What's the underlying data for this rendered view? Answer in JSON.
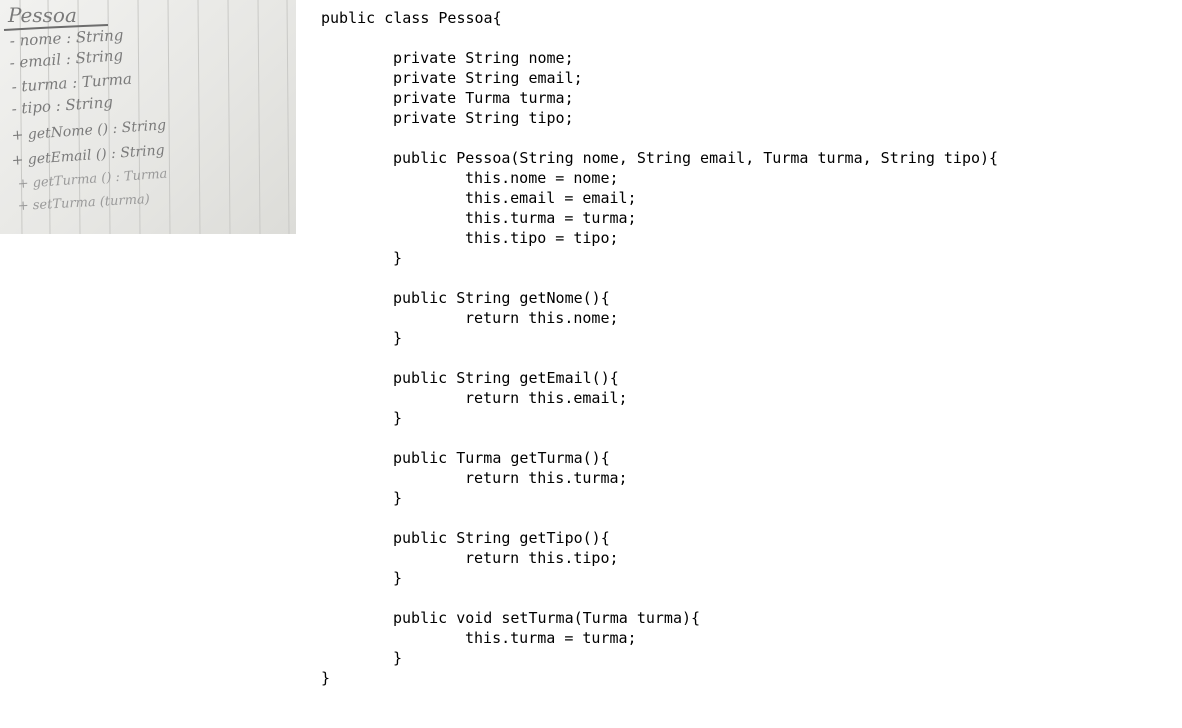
{
  "handwritten_note": {
    "lines": [
      "Pessoa",
      "- nome : String",
      "- email : String",
      "- turma : Turma",
      "- tipo : String",
      "+ getNome () : String",
      "+ getEmail () : String",
      "+ getTurma () : Turma",
      "+ setTurma (turma)"
    ]
  },
  "code": {
    "lines": [
      "public class Pessoa{",
      "",
      "private String nome;",
      "private String email;",
      "private Turma turma;",
      "private String tipo;",
      "",
      "public Pessoa(String nome, String email, Turma turma, String tipo){",
      "this.nome = nome;",
      "this.email = email;",
      "this.turma = turma;",
      "this.tipo = tipo;",
      "}",
      "",
      "public String getNome(){",
      "return this.nome;",
      "}",
      "",
      "public String getEmail(){",
      "return this.email;",
      "}",
      "",
      "public Turma getTurma(){",
      "return this.turma;",
      "}",
      "",
      "public String getTipo(){",
      "return this.tipo;",
      "}",
      "",
      "public void setTurma(Turma turma){",
      "this.turma = turma;",
      "}",
      "}"
    ]
  }
}
